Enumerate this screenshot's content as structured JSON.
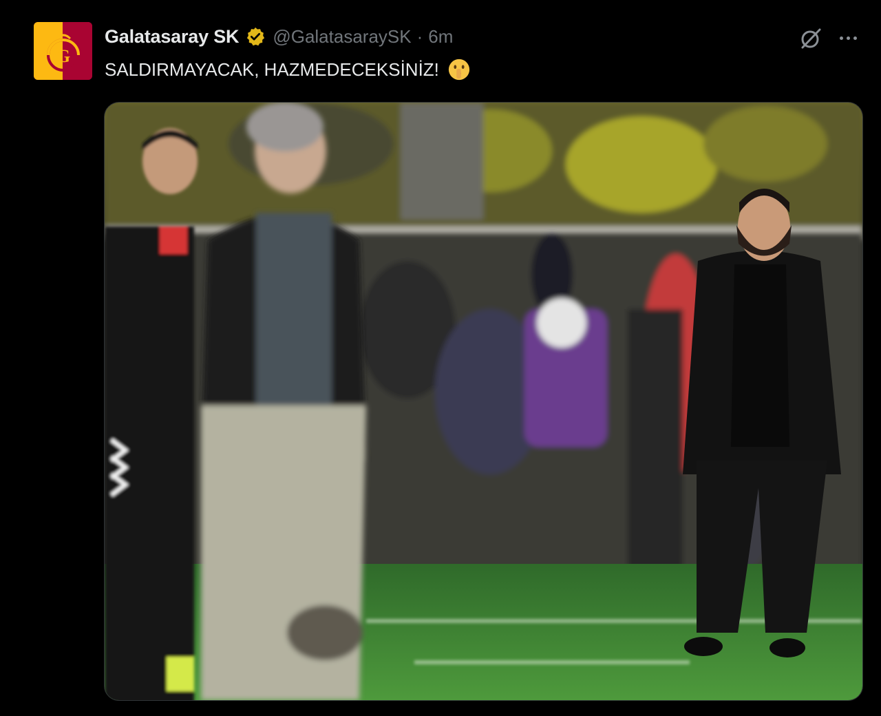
{
  "tweet": {
    "author": {
      "display_name": "Galatasaray SK",
      "handle": "@GalatasaraySK",
      "verified": true,
      "avatar_icon": "galatasaray-crest-icon"
    },
    "separator": "·",
    "timestamp": "6m",
    "text": "SALDIRMAYACAK, HAZMEDECEKSİNİZ!",
    "emoji": "shushing-face-emoji",
    "actions": {
      "grok_icon": "grok-icon",
      "more_icon": "more-options-icon"
    },
    "media": {
      "kind": "photo",
      "icon": "football-sideline-photo"
    }
  },
  "colors": {
    "background": "#000000",
    "text_primary": "#e7e9ea",
    "text_secondary": "#71767b",
    "verified_badge": "#e2b719",
    "galatasaray_red": "#a90432",
    "galatasaray_yellow": "#fdb912"
  }
}
